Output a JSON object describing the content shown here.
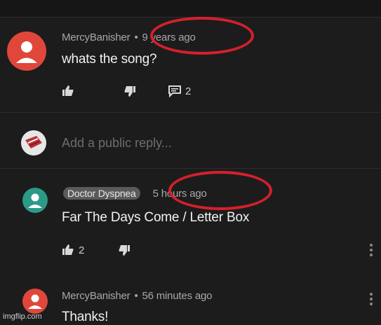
{
  "comments": [
    {
      "author": "MercyBanisher",
      "age": "9 years ago",
      "text": "whats the song?",
      "likes": "",
      "replies": "2",
      "avatar_color": "#e0473b"
    },
    {
      "author": "Doctor Dyspnea",
      "age": "5 hours ago",
      "text": "Far The Days Come / Letter Box",
      "likes": "2",
      "avatar_color": "#2c9a87"
    },
    {
      "author": "MercyBanisher",
      "age": "56 minutes ago",
      "text": "Thanks!",
      "avatar_color": "#e0473b"
    }
  ],
  "reply_box": {
    "placeholder": "Add a public reply..."
  },
  "separator": "•",
  "watermark": "imgflip.com",
  "highlight_color": "#d4202c",
  "icons": [
    "like-icon",
    "dislike-icon",
    "reply-icon",
    "more-icon"
  ]
}
